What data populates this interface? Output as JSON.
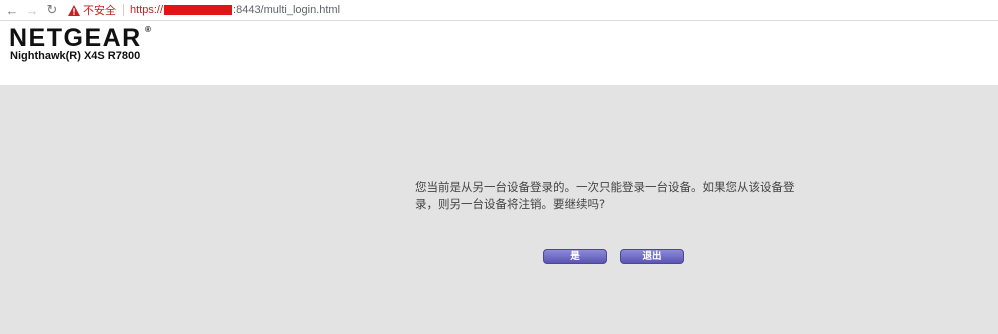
{
  "browser": {
    "security_label": "不安全",
    "url_scheme": "https://",
    "url_port_path": ":8443/multi_login.html"
  },
  "header": {
    "brand": "NETGEAR",
    "brand_mark": "®",
    "model": "Nighthawk(R) X4S R7800"
  },
  "dialog": {
    "message": "您当前是从另一台设备登录的。一次只能登录一台设备。如果您从该设备登录，则另一台设备将注销。要继续吗?",
    "yes_label": "是",
    "logout_label": "退出"
  },
  "colors": {
    "button_top": "#8d8ad6",
    "button_bottom": "#5a55b4",
    "background": "#e3e3e3",
    "warning_red": "#c5221f"
  }
}
